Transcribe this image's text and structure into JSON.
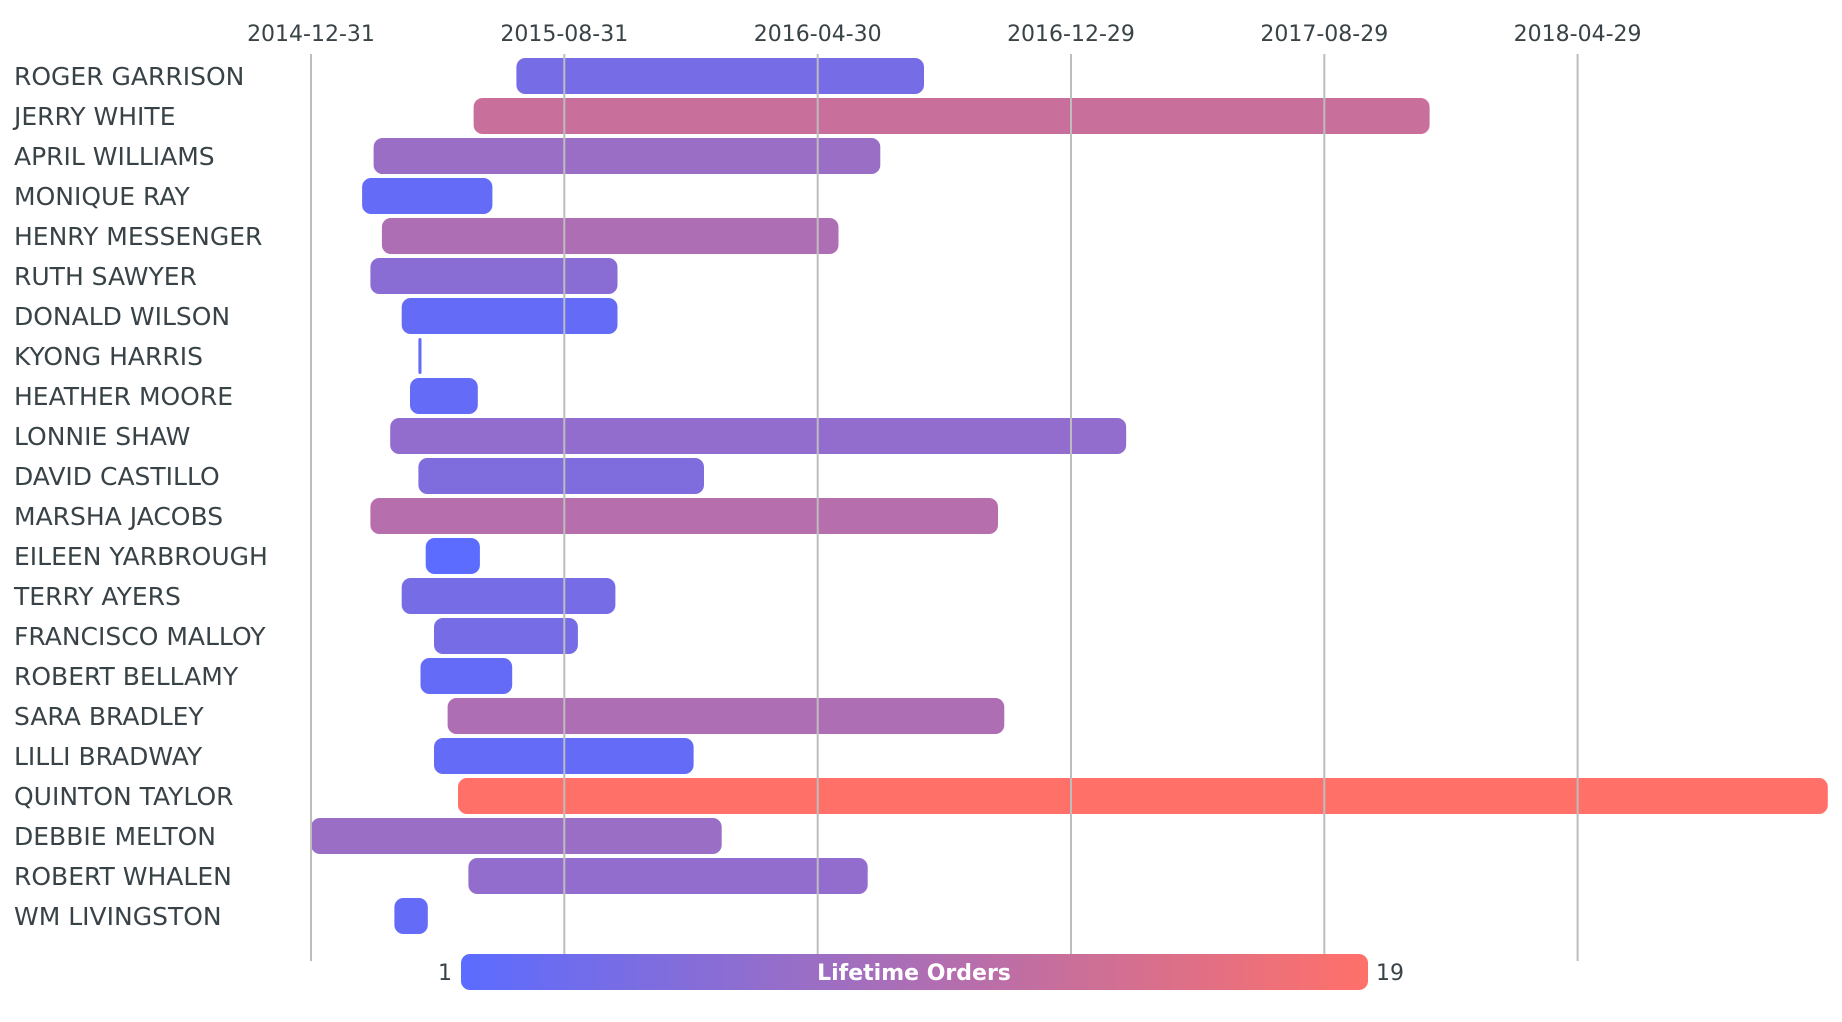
{
  "chart_data": {
    "type": "gantt",
    "title": "",
    "xlabel": "",
    "ylabel": "",
    "x_axis": {
      "type": "date",
      "range": [
        "2014-12-31",
        "2019-01-01"
      ],
      "ticks": [
        "2014-12-31",
        "2015-08-31",
        "2016-04-30",
        "2016-12-29",
        "2017-08-29",
        "2018-04-29"
      ],
      "position": "top",
      "grid": true
    },
    "color_scale": {
      "title": "Lifetime Orders",
      "min": 1,
      "max": 19,
      "min_color": "#5b6cff",
      "max_color": "#ff7069",
      "placement": "bottom-center"
    },
    "rows": [
      {
        "name": "ROGER GARRISON",
        "start": "2015-07-16",
        "end": "2016-08-10",
        "lifetime_orders": 4
      },
      {
        "name": "JERRY WHITE",
        "start": "2015-06-05",
        "end": "2017-12-08",
        "lifetime_orders": 13
      },
      {
        "name": "APRIL WILLIAMS",
        "start": "2015-03-01",
        "end": "2016-06-29",
        "lifetime_orders": 8
      },
      {
        "name": "MONIQUE RAY",
        "start": "2015-02-18",
        "end": "2015-06-23",
        "lifetime_orders": 2
      },
      {
        "name": "HENRY MESSENGER",
        "start": "2015-03-09",
        "end": "2016-05-20",
        "lifetime_orders": 10
      },
      {
        "name": "RUTH SAWYER",
        "start": "2015-02-26",
        "end": "2015-10-21",
        "lifetime_orders": 6
      },
      {
        "name": "DONALD WILSON",
        "start": "2015-03-28",
        "end": "2015-10-21",
        "lifetime_orders": 2
      },
      {
        "name": "KYONG HARRIS",
        "start": "2015-04-13",
        "end": "2015-04-16",
        "lifetime_orders": 2
      },
      {
        "name": "HEATHER MOORE",
        "start": "2015-04-05",
        "end": "2015-06-09",
        "lifetime_orders": 2
      },
      {
        "name": "LONNIE SHAW",
        "start": "2015-03-17",
        "end": "2017-02-20",
        "lifetime_orders": 7
      },
      {
        "name": "DAVID CASTILLO",
        "start": "2015-04-13",
        "end": "2016-01-12",
        "lifetime_orders": 5
      },
      {
        "name": "MARSHA JACOBS",
        "start": "2015-02-26",
        "end": "2016-10-20",
        "lifetime_orders": 11
      },
      {
        "name": "EILEEN YARBROUGH",
        "start": "2015-04-20",
        "end": "2015-06-11",
        "lifetime_orders": 1
      },
      {
        "name": "TERRY AYERS",
        "start": "2015-03-28",
        "end": "2015-10-19",
        "lifetime_orders": 4
      },
      {
        "name": "FRANCISCO MALLOY",
        "start": "2015-04-28",
        "end": "2015-09-13",
        "lifetime_orders": 4
      },
      {
        "name": "ROBERT BELLAMY",
        "start": "2015-04-15",
        "end": "2015-07-12",
        "lifetime_orders": 2
      },
      {
        "name": "SARA BRADLEY",
        "start": "2015-05-11",
        "end": "2016-10-26",
        "lifetime_orders": 10
      },
      {
        "name": "LILLI BRADWAY",
        "start": "2015-04-28",
        "end": "2016-01-02",
        "lifetime_orders": 2
      },
      {
        "name": "QUINTON TAYLOR",
        "start": "2015-05-21",
        "end": "2018-12-25",
        "lifetime_orders": 19
      },
      {
        "name": "DEBBIE MELTON",
        "start": "2014-12-31",
        "end": "2016-01-29",
        "lifetime_orders": 8
      },
      {
        "name": "ROBERT WHALEN",
        "start": "2015-05-31",
        "end": "2016-06-17",
        "lifetime_orders": 7
      },
      {
        "name": "WM LIVINGSTON",
        "start": "2015-03-21",
        "end": "2015-04-22",
        "lifetime_orders": 2
      }
    ]
  },
  "legend": {
    "title": "Lifetime Orders",
    "min_label": "1",
    "max_label": "19"
  }
}
